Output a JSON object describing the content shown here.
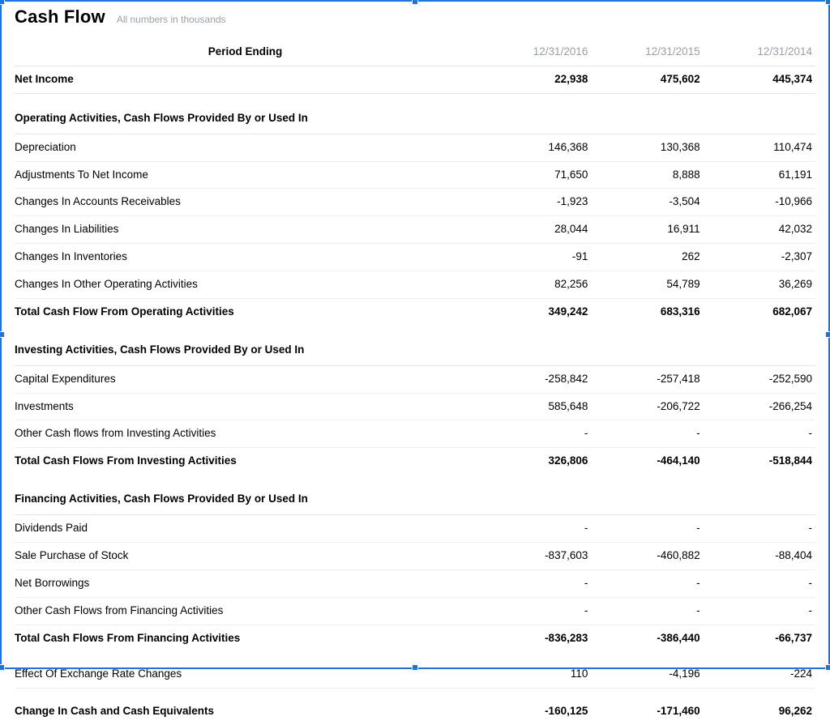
{
  "title": "Cash Flow",
  "subtitle": "All numbers in thousands",
  "columns": [
    "12/31/2016",
    "12/31/2015",
    "12/31/2014"
  ],
  "period_label": "Period Ending",
  "rows": [
    {
      "kind": "net",
      "label": "Net Income",
      "v": [
        "22,938",
        "475,602",
        "445,374"
      ]
    },
    {
      "kind": "section",
      "label": "Operating Activities, Cash Flows Provided By or Used In"
    },
    {
      "kind": "line",
      "label": "Depreciation",
      "v": [
        "146,368",
        "130,368",
        "110,474"
      ]
    },
    {
      "kind": "line",
      "label": "Adjustments To Net Income",
      "v": [
        "71,650",
        "8,888",
        "61,191"
      ]
    },
    {
      "kind": "line",
      "label": "Changes In Accounts Receivables",
      "v": [
        "-1,923",
        "-3,504",
        "-10,966"
      ]
    },
    {
      "kind": "line",
      "label": "Changes In Liabilities",
      "v": [
        "28,044",
        "16,911",
        "42,032"
      ]
    },
    {
      "kind": "line",
      "label": "Changes In Inventories",
      "v": [
        "-91",
        "262",
        "-2,307"
      ]
    },
    {
      "kind": "line",
      "label": "Changes In Other Operating Activities",
      "v": [
        "82,256",
        "54,789",
        "36,269"
      ]
    },
    {
      "kind": "bold",
      "label": "Total Cash Flow From Operating Activities",
      "v": [
        "349,242",
        "683,316",
        "682,067"
      ]
    },
    {
      "kind": "section",
      "label": "Investing Activities, Cash Flows Provided By or Used In"
    },
    {
      "kind": "line",
      "label": "Capital Expenditures",
      "v": [
        "-258,842",
        "-257,418",
        "-252,590"
      ]
    },
    {
      "kind": "line",
      "label": "Investments",
      "v": [
        "585,648",
        "-206,722",
        "-266,254"
      ]
    },
    {
      "kind": "line",
      "label": "Other Cash flows from Investing Activities",
      "v": [
        "-",
        "-",
        "-"
      ]
    },
    {
      "kind": "bold",
      "label": "Total Cash Flows From Investing Activities",
      "v": [
        "326,806",
        "-464,140",
        "-518,844"
      ]
    },
    {
      "kind": "section",
      "label": "Financing Activities, Cash Flows Provided By or Used In"
    },
    {
      "kind": "line",
      "label": "Dividends Paid",
      "v": [
        "-",
        "-",
        "-"
      ]
    },
    {
      "kind": "line",
      "label": "Sale Purchase of Stock",
      "v": [
        "-837,603",
        "-460,882",
        "-88,404"
      ]
    },
    {
      "kind": "line",
      "label": "Net Borrowings",
      "v": [
        "-",
        "-",
        "-"
      ]
    },
    {
      "kind": "line",
      "label": "Other Cash Flows from Financing Activities",
      "v": [
        "-",
        "-",
        "-"
      ]
    },
    {
      "kind": "bold",
      "label": "Total Cash Flows From Financing Activities",
      "v": [
        "-836,283",
        "-386,440",
        "-66,737"
      ]
    },
    {
      "kind": "spacer"
    },
    {
      "kind": "line",
      "label": "Effect Of Exchange Rate Changes",
      "v": [
        "110",
        "-4,196",
        "-224"
      ]
    },
    {
      "kind": "spacer"
    },
    {
      "kind": "bold",
      "label": "Change In Cash and Cash Equivalents",
      "v": [
        "-160,125",
        "-171,460",
        "96,262"
      ]
    }
  ]
}
